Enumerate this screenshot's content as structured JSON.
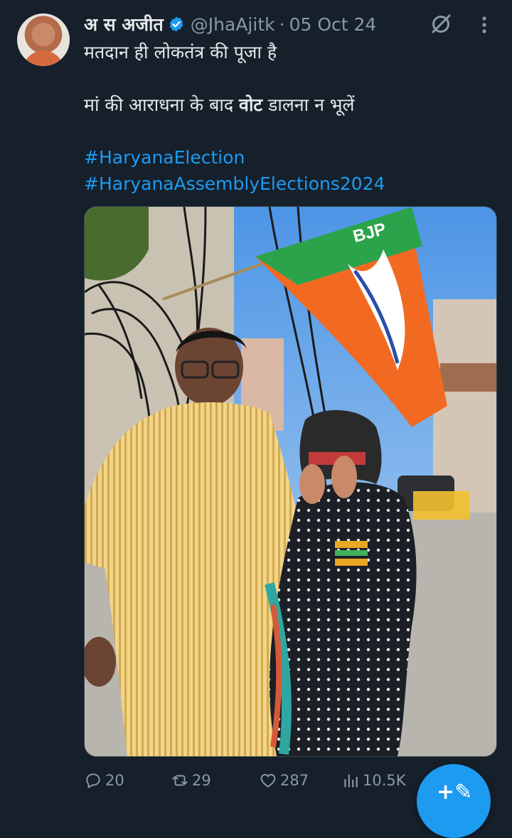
{
  "tweet": {
    "display_name": "अ स अजीत",
    "handle": "@JhaAjitk",
    "separator": "·",
    "date": "05 Oct 24",
    "line1": "मतदान ही लोकतंत्र की पूजा है",
    "line2_before": "मां की आराधना के बाद ",
    "line2_bold": "वोट",
    "line2_after": " डालना न भूलें",
    "hashtags": [
      "#HaryanaElection",
      "#HaryanaAssemblyElections2024"
    ]
  },
  "media": {
    "flag_text": "BJP"
  },
  "actions": {
    "replies": "20",
    "reposts": "29",
    "likes": "287",
    "views": "10.5K"
  },
  "fab": {
    "icon_text": "+✎"
  },
  "colors": {
    "background": "#15202b",
    "accent": "#1d9bf0",
    "muted": "#8b98a5",
    "text": "#e7e9ea"
  }
}
